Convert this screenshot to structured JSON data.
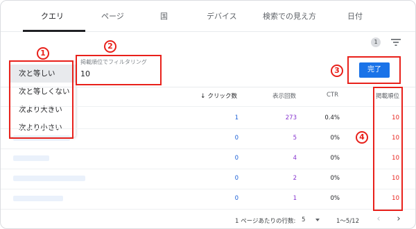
{
  "tabs": [
    {
      "label": "クエリ",
      "active": true
    },
    {
      "label": "ページ"
    },
    {
      "label": "国"
    },
    {
      "label": "デバイス"
    },
    {
      "label": "検索での見え方"
    },
    {
      "label": "日付"
    }
  ],
  "filter_count": "1",
  "filter_icon": "filter-list-icon",
  "dropdown": {
    "items": [
      "次と等しい",
      "次と等しくない",
      "次より大きい",
      "次より小さい"
    ],
    "selected": "次と等しい"
  },
  "filter_input": {
    "label": "掲載順位でフィルタリング",
    "value": "10"
  },
  "done_button": "完了",
  "annotations": [
    "1",
    "2",
    "3",
    "4"
  ],
  "annotation_color": "#e8201a",
  "table": {
    "headers": {
      "clicks": "クリック数",
      "impressions": "表示回数",
      "ctr": "CTR",
      "position": "掲載順位"
    },
    "sort_icon": "arrow-down-icon",
    "rows": [
      {
        "clicks": "1",
        "impressions": "273",
        "ctr": "0.4%",
        "position": "10"
      },
      {
        "clicks": "0",
        "impressions": "5",
        "ctr": "0%",
        "position": "10"
      },
      {
        "clicks": "0",
        "impressions": "4",
        "ctr": "0%",
        "position": "10"
      },
      {
        "clicks": "0",
        "impressions": "2",
        "ctr": "0%",
        "position": "10"
      },
      {
        "clicks": "0",
        "impressions": "1",
        "ctr": "0%",
        "position": "10"
      }
    ]
  },
  "footer": {
    "rows_per_page_label": "1 ページあたりの行数:",
    "rows_per_page_value": "5",
    "range": "1〜5/12"
  },
  "colors": {
    "accent": "#1a73e8",
    "clicks": "#1a5fd6",
    "impressions": "#8430ce"
  }
}
